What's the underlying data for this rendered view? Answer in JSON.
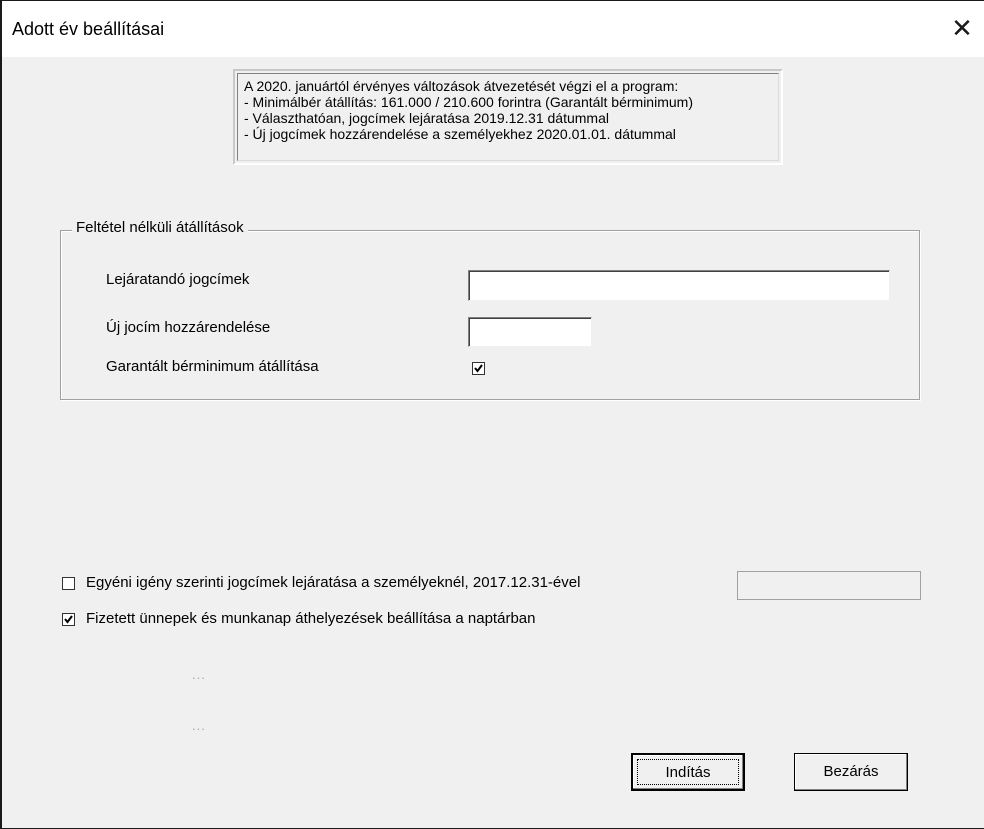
{
  "window": {
    "title": "Adott év beállításai",
    "close_symbol": "✕"
  },
  "info": {
    "lines": [
      "A 2020. januártól érvényes változások átvezetését végzi el a program:",
      "- Minimálbér átállítás: 161.000 / 210.600 forintra (Garantált bérminimum)",
      "- Választhatóan, jogcímek lejáratása 2019.12.31 dátummal",
      "- Új jogcímek hozzárendelése a személyekhez 2020.01.01. dátummal"
    ]
  },
  "group": {
    "legend": "Feltétel nélküli átállítások",
    "expiring_label": "Lejáratandó jogcímek",
    "expiring_value": "",
    "new_label": "Új jocím hozzárendelése",
    "new_value": "",
    "guaranteed_label": "Garantált bérminimum átállítása",
    "guaranteed_checked": true
  },
  "options": {
    "individual_label": "Egyéni igény szerinti jogcímek lejáratása a személyeknél, 2017.12.31-ével",
    "individual_checked": false,
    "individual_value": "",
    "holidays_label": "Fizetett ünnepek és munkanap áthelyezések beállítása a naptárban",
    "holidays_checked": true
  },
  "placeholders": {
    "dots_1": "...",
    "dots_2": "..."
  },
  "buttons": {
    "start_label": "Indítás",
    "close_label": "Bezárás"
  },
  "colors": {
    "dialog_bg": "#f0f0f0",
    "titlebar_bg": "#ffffff",
    "dots": "#9aa6c8"
  }
}
